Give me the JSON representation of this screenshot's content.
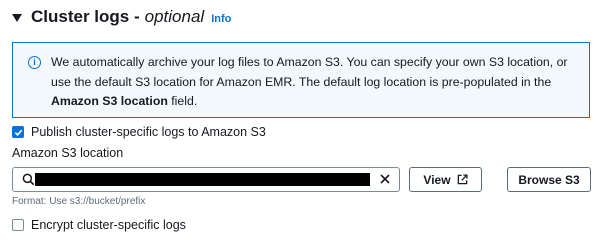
{
  "section": {
    "title": "Cluster logs -",
    "optional": "optional",
    "info": "Info"
  },
  "alert": {
    "text_part1": "We automatically archive your log files to Amazon S3. You can specify your own S3 location, or use the default S3 location for Amazon EMR. The default log location is pre-populated in the ",
    "bold_part": "Amazon S3 location",
    "text_part2": " field."
  },
  "publish_logs": {
    "label": "Publish cluster-specific logs to Amazon S3",
    "checked": true
  },
  "s3_location": {
    "label": "Amazon S3 location",
    "value": "",
    "format_hint": "Format: Use s3://bucket/prefix"
  },
  "buttons": {
    "view": "View",
    "browse": "Browse S3"
  },
  "encrypt_logs": {
    "label": "Encrypt cluster-specific logs",
    "checked": false
  },
  "colors": {
    "accent": "#0972d3",
    "alert_bg": "#f2f8fd",
    "text": "#16191f",
    "muted": "#5f6b7a"
  }
}
